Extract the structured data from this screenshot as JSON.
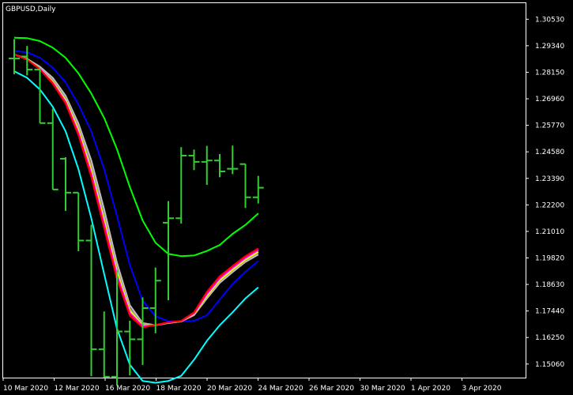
{
  "window": {
    "title": "GBPUSD,Daily"
  },
  "colors": {
    "background": "#000000",
    "frame": "#ffffff",
    "bars": "#32cd32",
    "axis_text": "#ffffff"
  },
  "chart_data": {
    "type": "line",
    "symbol": "GBPUSD",
    "timeframe": "Daily",
    "price_labels": [
      "1.30530",
      "1.29340",
      "1.28150",
      "1.26960",
      "1.25770",
      "1.24580",
      "1.23390",
      "1.22200",
      "1.21010",
      "1.19820",
      "1.18630",
      "1.17440",
      "1.16250",
      "1.15060"
    ],
    "date_labels": [
      "10 Mar 2020",
      "12 Mar 2020",
      "16 Mar 2020",
      "18 Mar 2020",
      "20 Mar 2020",
      "24 Mar 2020",
      "26 Mar 2020",
      "30 Mar 2020",
      "1 Apr 2020",
      "3 Apr 2020"
    ],
    "ylim": [
      1.1445,
      1.3125
    ],
    "ohlc": [
      {
        "o": 1.2877,
        "h": 1.2964,
        "l": 1.2806,
        "c": 1.2877
      },
      {
        "o": 1.2886,
        "h": 1.2933,
        "l": 1.2801,
        "c": 1.2827
      },
      {
        "o": 1.2827,
        "h": 1.2833,
        "l": 1.2587,
        "c": 1.2587
      },
      {
        "o": 1.2587,
        "h": 1.2652,
        "l": 1.2289,
        "c": 1.2289
      },
      {
        "o": 1.2427,
        "h": 1.2434,
        "l": 1.2193,
        "c": 1.2275
      },
      {
        "o": 1.2275,
        "h": 1.2275,
        "l": 1.2012,
        "c": 1.206
      },
      {
        "o": 1.206,
        "h": 1.2131,
        "l": 1.1451,
        "c": 1.1572
      },
      {
        "o": 1.1572,
        "h": 1.1742,
        "l": 1.1445,
        "c": 1.1449
      },
      {
        "o": 1.1449,
        "h": 1.1928,
        "l": 1.1409,
        "c": 1.1652
      },
      {
        "o": 1.1652,
        "h": 1.17,
        "l": 1.1455,
        "c": 1.1617
      },
      {
        "o": 1.1617,
        "h": 1.1805,
        "l": 1.1502,
        "c": 1.1757
      },
      {
        "o": 1.1757,
        "h": 1.1939,
        "l": 1.1644,
        "c": 1.188
      },
      {
        "o": 1.214,
        "h": 1.2237,
        "l": 1.1792,
        "c": 1.216
      },
      {
        "o": 1.216,
        "h": 1.2479,
        "l": 1.2136,
        "c": 1.2441
      },
      {
        "o": 1.2441,
        "h": 1.2468,
        "l": 1.2376,
        "c": 1.2413
      },
      {
        "o": 1.2413,
        "h": 1.2485,
        "l": 1.231,
        "c": 1.2419
      },
      {
        "o": 1.2419,
        "h": 1.2448,
        "l": 1.2344,
        "c": 1.237
      },
      {
        "o": 1.2382,
        "h": 1.2486,
        "l": 1.2358,
        "c": 1.2382
      },
      {
        "o": 1.2403,
        "h": 1.2404,
        "l": 1.2206,
        "c": 1.2254
      },
      {
        "o": 1.2254,
        "h": 1.235,
        "l": 1.2226,
        "c": 1.2297
      }
    ],
    "series": [
      {
        "color": "#00ff00",
        "values": [
          1.297,
          1.2968,
          1.2955,
          1.2925,
          1.288,
          1.281,
          1.272,
          1.261,
          1.247,
          1.23,
          1.215,
          1.205,
          1.2,
          1.199,
          1.1993,
          1.2013,
          1.204,
          1.209,
          1.213,
          1.2182
        ]
      },
      {
        "color": "#0000ff",
        "values": [
          1.291,
          1.2905,
          1.288,
          1.2835,
          1.277,
          1.267,
          1.255,
          1.238,
          1.217,
          1.195,
          1.179,
          1.172,
          1.1698,
          1.1697,
          1.17,
          1.1725,
          1.1795,
          1.1865,
          1.192,
          1.1968
        ]
      },
      {
        "color": "#c0c0c0",
        "values": [
          1.2895,
          1.2875,
          1.284,
          1.279,
          1.271,
          1.2585,
          1.242,
          1.22,
          1.196,
          1.177,
          1.169,
          1.168,
          1.169,
          1.1697,
          1.1725,
          1.18,
          1.187,
          1.1918,
          1.1964,
          1.1997
        ]
      },
      {
        "color": "#a0a0a0",
        "values": [
          1.2895,
          1.2873,
          1.2835,
          1.278,
          1.27,
          1.257,
          1.2395,
          1.217,
          1.1935,
          1.1755,
          1.1685,
          1.168,
          1.169,
          1.1697,
          1.1728,
          1.1808,
          1.1878,
          1.1926,
          1.197,
          1.2005
        ]
      },
      {
        "color": "#ffff00",
        "values": [
          1.2895,
          1.2873,
          1.2832,
          1.2772,
          1.269,
          1.2555,
          1.2375,
          1.215,
          1.192,
          1.1745,
          1.168,
          1.168,
          1.1691,
          1.1697,
          1.173,
          1.1812,
          1.1882,
          1.193,
          1.1974,
          1.201
        ]
      },
      {
        "color": "#ff00ff",
        "values": [
          1.2895,
          1.2872,
          1.283,
          1.2768,
          1.2682,
          1.2543,
          1.236,
          1.2133,
          1.1905,
          1.1735,
          1.1676,
          1.168,
          1.1692,
          1.1698,
          1.1733,
          1.182,
          1.189,
          1.1938,
          1.1982,
          1.2018
        ]
      },
      {
        "color": "#ff0000",
        "values": [
          1.2895,
          1.2872,
          1.2828,
          1.2764,
          1.2675,
          1.2532,
          1.2345,
          1.2115,
          1.1888,
          1.1723,
          1.167,
          1.1682,
          1.1693,
          1.17,
          1.1738,
          1.183,
          1.19,
          1.1946,
          1.199,
          1.2025
        ]
      },
      {
        "color": "#00ffff",
        "values": [
          1.282,
          1.279,
          1.2738,
          1.266,
          1.255,
          1.238,
          1.216,
          1.191,
          1.1665,
          1.1503,
          1.143,
          1.1422,
          1.143,
          1.1453,
          1.1525,
          1.161,
          1.168,
          1.1738,
          1.18,
          1.185
        ]
      }
    ]
  }
}
